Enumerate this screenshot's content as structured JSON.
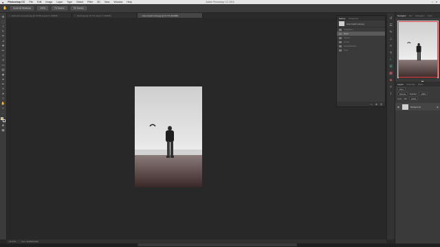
{
  "menubar": {
    "app_name": "Photoshop CC",
    "items": [
      "File",
      "Edit",
      "Image",
      "Layer",
      "Type",
      "Select",
      "Filter",
      "3D",
      "View",
      "Window",
      "Help"
    ],
    "window_title": "Adobe Photoshop CC 2015"
  },
  "options_bar": {
    "buttons": [
      "Scroll All Windows",
      "100%",
      "Fit Screen",
      "Fill Screen"
    ]
  },
  "tabs": [
    {
      "label": "dusk and mountain.jpg @ 12.5% (Layer 0, RGB/8)",
      "active": false
    },
    {
      "label": "beach.jpg @ 16.7% (Layer 0, RGB/8)",
      "active": false
    },
    {
      "label": "silver beach man.jpg @ 16.7% (RGB/8)",
      "active": true
    }
  ],
  "history_panel": {
    "tabs": [
      "History",
      "Properties"
    ],
    "snapshot_label": "silver beach man.jpg",
    "steps": [
      "Snapshot 1",
      "Open",
      "Curves",
      "Levels",
      "Hue/Saturation",
      "Crop"
    ],
    "current_step_index": 1
  },
  "navigator": {
    "tabs": [
      "Navigator",
      "Info",
      "Histogram",
      "Color"
    ],
    "zoom": "16.67%"
  },
  "layers_panel": {
    "tabs": [
      "Layers",
      "Channels",
      "Paths"
    ],
    "kind_label": "Kind",
    "blend_mode": "Normal",
    "opacity_label": "Opacity:",
    "opacity_value": "100%",
    "lock_label": "Lock:",
    "fill_label": "Fill:",
    "fill_value": "100%",
    "layer_name": "Background"
  },
  "status": {
    "zoom": "16.67%",
    "doc_size": "Doc: 22.9M/22.9M"
  },
  "colors": {
    "foreground": "#d7a12c",
    "background": "#111111",
    "accent_red": "#e0404a"
  }
}
